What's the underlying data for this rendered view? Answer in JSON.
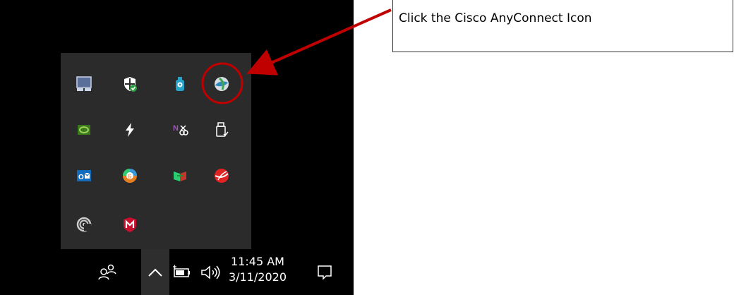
{
  "callout": {
    "text": "Click the Cisco AnyConnect Icon"
  },
  "taskbar": {
    "time": "11:45 AM",
    "date": "3/11/2020"
  },
  "tray_icons": [
    "touchpad-icon",
    "windows-security-icon",
    "usb-device-icon",
    "cisco-anyconnect-icon",
    "nvidia-icon",
    "power-icon",
    "onenote-send-icon",
    "safely-remove-hardware-icon",
    "outlook-icon",
    "app-6-icon",
    "green-red-app-icon",
    "red-globe-app-icon",
    "spiral-app-icon",
    "mcafee-icon"
  ],
  "colors": {
    "annotation": "#c00000",
    "desktop": "#000000",
    "flyout": "#2b2b2b"
  }
}
